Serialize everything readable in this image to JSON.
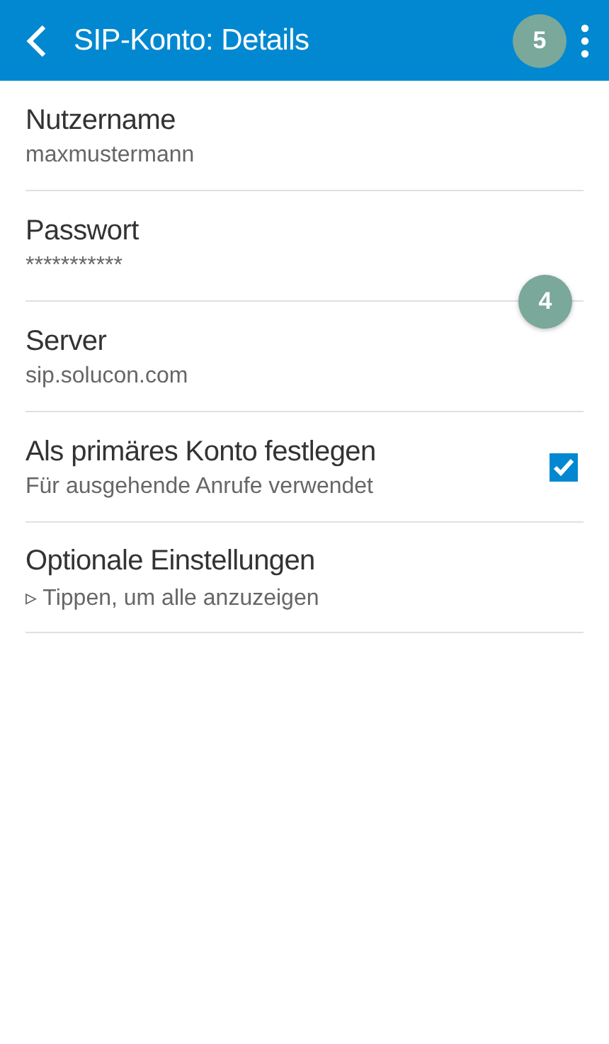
{
  "app_bar": {
    "title": "SIP-Konto: Details",
    "badge": "5"
  },
  "rows": [
    {
      "kind": "text",
      "title": "Nutzername",
      "subtitle": "maxmustermann"
    },
    {
      "kind": "text",
      "title": "Passwort",
      "subtitle": "***********"
    },
    {
      "kind": "text",
      "title": "Server",
      "subtitle": "sip.solucon.com"
    },
    {
      "kind": "checkbox",
      "title": "Als primäres Konto festlegen",
      "subtitle": "Für ausgehende Anrufe verwendet",
      "checked": true
    },
    {
      "kind": "text",
      "title": "Optionale Einstellungen",
      "subtitle": "▹ Tippen, um alle anzuzeigen"
    }
  ],
  "marker": {
    "label": "4"
  }
}
